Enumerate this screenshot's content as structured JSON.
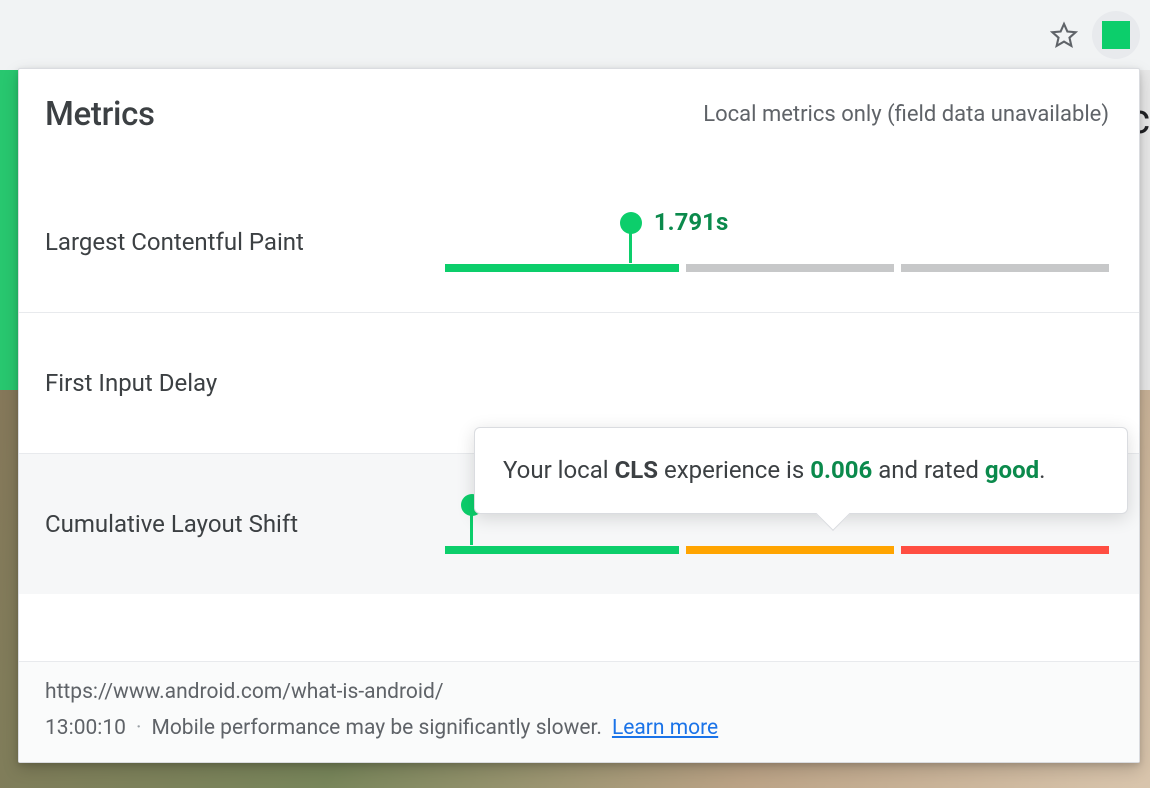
{
  "header": {
    "title": "Metrics",
    "subtitle": "Local metrics only (field data unavailable)"
  },
  "metrics": {
    "lcp": {
      "label": "Largest Contentful Paint",
      "value": "1.791s",
      "marker_percent": 28,
      "segments": [
        {
          "color": "green",
          "percent": 36
        },
        {
          "color": "grey",
          "percent": 32
        },
        {
          "color": "grey",
          "percent": 32
        }
      ]
    },
    "fid": {
      "label": "First Input Delay"
    },
    "cls": {
      "label": "Cumulative Layout Shift",
      "value": "0.006",
      "marker_percent": 4,
      "segments": [
        {
          "color": "green",
          "percent": 36
        },
        {
          "color": "amber",
          "percent": 32
        },
        {
          "color": "red",
          "percent": 32
        }
      ]
    }
  },
  "tooltip": {
    "prefix": "Your local ",
    "metric": "CLS",
    "mid1": " experience is ",
    "value": "0.006",
    "mid2": " and rated ",
    "rating": "good",
    "suffix": "."
  },
  "footer": {
    "url": "https://www.android.com/what-is-android/",
    "time": "13:00:10",
    "separator": "·",
    "note": "Mobile performance may be significantly slower.",
    "learn_more": "Learn more"
  },
  "colors": {
    "good": "#0cce6b",
    "amber": "#ffa400",
    "red": "#ff4e42"
  }
}
